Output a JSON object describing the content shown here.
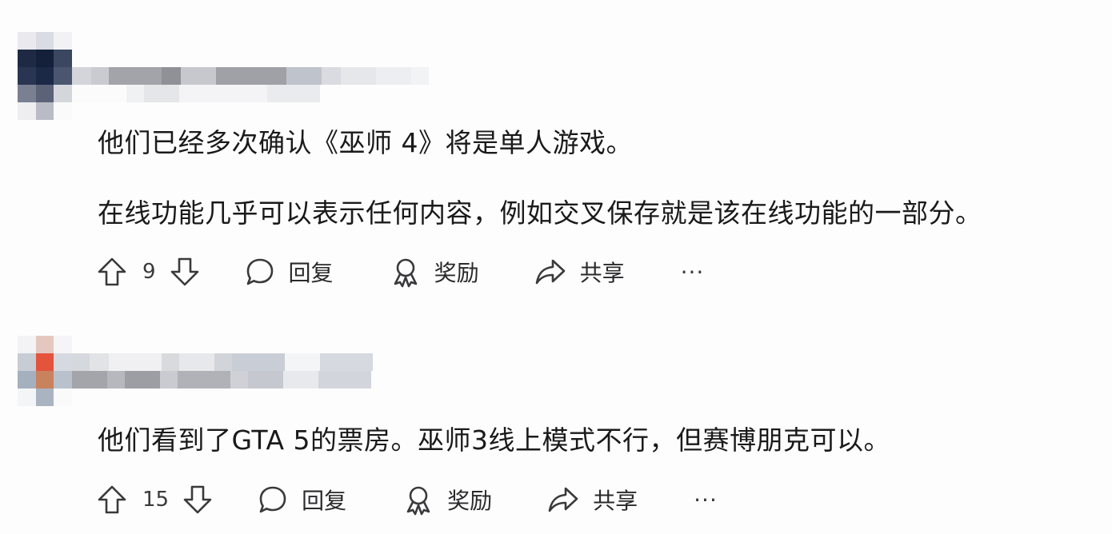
{
  "comments": [
    {
      "text_lines": [
        "他们已经多次确认《巫师 4》将是单人游戏。",
        "在线功能几乎可以表示任何内容，例如交叉保存就是该在线功能的一部分。"
      ],
      "votes": "9",
      "reply_label": "回复",
      "award_label": "奖励",
      "share_label": "共享",
      "more_label": "···"
    },
    {
      "text_lines": [
        "他们看到了GTA 5的票房。巫师3线上模式不行，但赛博朋克可以。"
      ],
      "votes": "15",
      "reply_label": "回复",
      "award_label": "奖励",
      "share_label": "共享",
      "more_label": "···"
    }
  ],
  "colors": {
    "text": "#1a1a1b",
    "icon": "#3a3a3c",
    "background": "#fdfdfd"
  },
  "icons": {
    "upvote": "arrow-up-icon",
    "downvote": "arrow-down-icon",
    "reply": "speech-bubble-icon",
    "award": "award-ribbon-icon",
    "share": "share-arrow-icon"
  }
}
